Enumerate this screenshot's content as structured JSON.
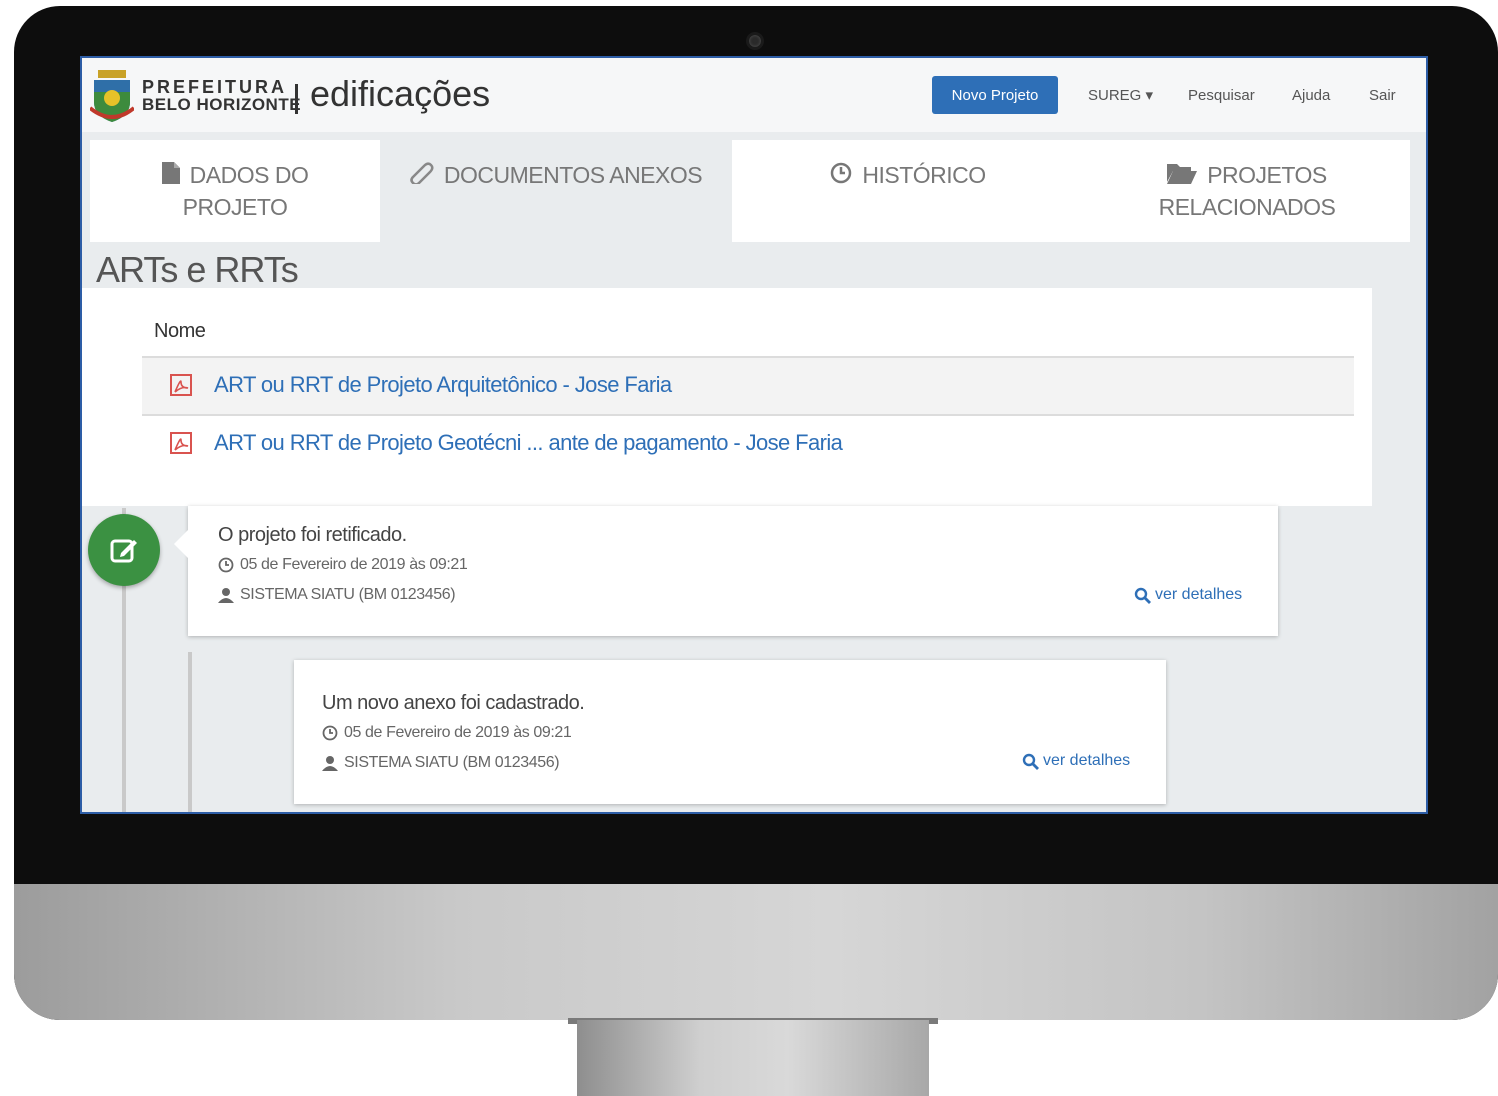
{
  "brand": {
    "line1": "PREFEITURA",
    "line2": "BELO HORIZONTE",
    "app": "edificações"
  },
  "nav": {
    "new_project": "Novo Projeto",
    "sureg": "SUREG ▾",
    "search": "Pesquisar",
    "help": "Ajuda",
    "exit": "Sair"
  },
  "tabs": [
    {
      "line1": "DADOS DO",
      "line2": "PROJETO",
      "icon": "file-icon"
    },
    {
      "line1": "DOCUMENTOS ANEXOS",
      "line2": "",
      "icon": "paperclip-icon"
    },
    {
      "line1": "HISTÓRICO",
      "line2": "",
      "icon": "clock-icon"
    },
    {
      "line1": "PROJETOS",
      "line2": "RELACIONADOS",
      "icon": "folder-open-icon"
    }
  ],
  "section": {
    "title": "ARTs e RRTs",
    "column_name": "Nome",
    "documents": [
      {
        "name": "ART ou RRT de Projeto Arquitetônico - Jose Faria"
      },
      {
        "name": "ART ou RRT de Projeto Geotécni ...  ante de pagamento - Jose Faria"
      }
    ]
  },
  "timeline": [
    {
      "title": "O projeto foi retificado.",
      "date": "05 de Fevereiro de 2019 às 09:21",
      "user": "SISTEMA SIATU (BM 0123456)",
      "details": "ver detalhes"
    },
    {
      "title": "Um novo anexo foi cadastrado.",
      "date": "05 de Fevereiro de 2019 às 09:21",
      "user": "SISTEMA SIATU (BM 0123456)",
      "details": "ver detalhes"
    }
  ],
  "colors": {
    "accent": "#2e6fb7",
    "success": "#3b9142",
    "pdf": "#d9534f"
  }
}
